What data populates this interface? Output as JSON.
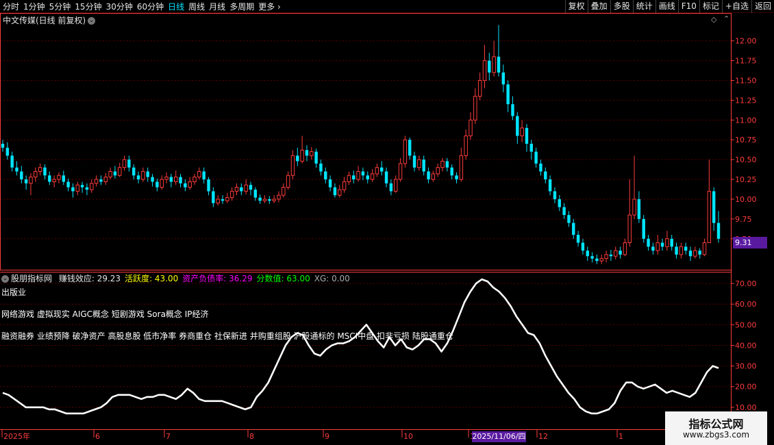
{
  "toolbar": {
    "periods": [
      "分时",
      "1分钟",
      "5分钟",
      "15分钟",
      "30分钟",
      "60分钟",
      "日线",
      "周线",
      "月线",
      "多周期",
      "更多 ›"
    ],
    "active_period": "日线",
    "tools": [
      "复权",
      "叠加",
      "多股",
      "统计",
      "画线",
      "F10",
      "标记",
      "+自选",
      "返回"
    ]
  },
  "main_panel": {
    "title": "中文传媒(日线 前复权)",
    "current_price": "9.31"
  },
  "indicator_panel": {
    "name": "股朋指标网",
    "fields": [
      {
        "label": "赚钱效应: ",
        "value": "29.23",
        "color": "#e6e6e6"
      },
      {
        "label": "活跃度: ",
        "value": "43.00",
        "color": "#ffff00"
      },
      {
        "label": "资产负债率: ",
        "value": "36.29",
        "color": "#ff00ff"
      },
      {
        "label": "分数值: ",
        "value": "63.00",
        "color": "#00ff00"
      },
      {
        "label": "XG: ",
        "value": "0.00",
        "color": "#aaaaaa"
      }
    ],
    "overlay_lines": [
      "出版业",
      "网络游戏 虚拟现实 AIGC概念 短剧游戏 Sora概念 IP经济",
      "融资融券 业绩预降 破净资产 高股息股 低市净率 券商重仓 社保新进 并购重组股 沪股通标的 MSCI中盘 扣非亏损 陆股通重仓"
    ]
  },
  "x_axis": {
    "labels": [
      "2025年",
      "6",
      "7",
      "8",
      "9",
      "10",
      "11",
      "12",
      "1"
    ],
    "crosshair_date": "2025/11/06/四"
  },
  "watermark": {
    "title": "指标公式网",
    "url": "www.zbgs3.com"
  },
  "colors": {
    "up": "#ff3c3c",
    "down": "#00e5ff",
    "line": "#ffffff",
    "grid": "#5a0000",
    "axis": "#ff3c3c"
  },
  "chart_data": [
    {
      "type": "candlestick",
      "title": "中文传媒(日线 前复权)",
      "ylim": [
        9.1,
        12.3
      ],
      "y_ticks": [
        9.5,
        9.75,
        10.0,
        10.25,
        10.5,
        10.75,
        11.0,
        11.25,
        11.5,
        11.75,
        12.0
      ],
      "points": [
        [
          10.7,
          10.65,
          10.75,
          10.6
        ],
        [
          10.65,
          10.55,
          10.72,
          10.5
        ],
        [
          10.55,
          10.4,
          10.6,
          10.35
        ],
        [
          10.4,
          10.35,
          10.48,
          10.3
        ],
        [
          10.35,
          10.25,
          10.42,
          10.2
        ],
        [
          10.25,
          10.2,
          10.3,
          10.12
        ],
        [
          10.2,
          10.28,
          10.33,
          10.05
        ],
        [
          10.28,
          10.35,
          10.4,
          10.22
        ],
        [
          10.35,
          10.4,
          10.45,
          10.3
        ],
        [
          10.4,
          10.3,
          10.44,
          10.25
        ],
        [
          10.3,
          10.22,
          10.35,
          10.18
        ],
        [
          10.22,
          10.25,
          10.3,
          10.15
        ],
        [
          10.25,
          10.3,
          10.34,
          10.2
        ],
        [
          10.3,
          10.22,
          10.36,
          10.18
        ],
        [
          10.22,
          10.15,
          10.26,
          10.1
        ],
        [
          10.15,
          10.1,
          10.2,
          10.02
        ],
        [
          10.1,
          10.18,
          10.22,
          10.05
        ],
        [
          10.18,
          10.15,
          10.22,
          10.08
        ],
        [
          10.15,
          10.12,
          10.2,
          10.05
        ],
        [
          10.12,
          10.2,
          10.25,
          10.08
        ],
        [
          10.2,
          10.25,
          10.3,
          10.16
        ],
        [
          10.25,
          10.22,
          10.3,
          10.18
        ],
        [
          10.22,
          10.28,
          10.33,
          10.18
        ],
        [
          10.28,
          10.35,
          10.4,
          10.25
        ],
        [
          10.35,
          10.3,
          10.42,
          10.26
        ],
        [
          10.3,
          10.4,
          10.46,
          10.28
        ],
        [
          10.4,
          10.5,
          10.55,
          10.36
        ],
        [
          10.5,
          10.4,
          10.55,
          10.35
        ],
        [
          10.4,
          10.3,
          10.44,
          10.25
        ],
        [
          10.3,
          10.25,
          10.35,
          10.2
        ],
        [
          10.25,
          10.35,
          10.4,
          10.22
        ],
        [
          10.35,
          10.28,
          10.4,
          10.22
        ],
        [
          10.28,
          10.22,
          10.32,
          10.16
        ],
        [
          10.22,
          10.15,
          10.26,
          10.1
        ],
        [
          10.15,
          10.25,
          10.3,
          10.12
        ],
        [
          10.25,
          10.28,
          10.34,
          10.2
        ],
        [
          10.28,
          10.22,
          10.32,
          10.15
        ],
        [
          10.22,
          10.28,
          10.36,
          10.18
        ],
        [
          10.28,
          10.2,
          10.32,
          10.15
        ],
        [
          10.2,
          10.15,
          10.25,
          10.1
        ],
        [
          10.15,
          10.22,
          10.28,
          10.12
        ],
        [
          10.22,
          10.28,
          10.32,
          10.18
        ],
        [
          10.28,
          10.35,
          10.4,
          10.25
        ],
        [
          10.35,
          10.25,
          10.4,
          10.2
        ],
        [
          10.25,
          10.1,
          10.28,
          10.05
        ],
        [
          10.1,
          9.95,
          10.15,
          9.9
        ],
        [
          9.95,
          10.0,
          10.05,
          9.92
        ],
        [
          10.0,
          9.98,
          10.05,
          9.94
        ],
        [
          9.98,
          10.02,
          10.08,
          9.95
        ],
        [
          10.02,
          10.1,
          10.15,
          9.98
        ],
        [
          10.1,
          10.15,
          10.2,
          10.05
        ],
        [
          10.15,
          10.1,
          10.2,
          10.05
        ],
        [
          10.1,
          10.18,
          10.25,
          10.06
        ],
        [
          10.18,
          10.12,
          10.22,
          10.05
        ],
        [
          10.12,
          10.02,
          10.15,
          9.98
        ],
        [
          10.02,
          9.98,
          10.06,
          9.94
        ],
        [
          9.98,
          10.0,
          10.05,
          9.95
        ],
        [
          10.0,
          9.98,
          10.04,
          9.94
        ],
        [
          9.98,
          10.0,
          10.05,
          9.95
        ],
        [
          10.0,
          10.05,
          10.1,
          9.96
        ],
        [
          10.05,
          10.15,
          10.2,
          10.02
        ],
        [
          10.15,
          10.3,
          10.35,
          10.12
        ],
        [
          10.3,
          10.55,
          10.62,
          10.25
        ],
        [
          10.55,
          10.48,
          10.65,
          10.42
        ],
        [
          10.48,
          10.62,
          10.8,
          10.45
        ],
        [
          10.62,
          10.55,
          10.68,
          10.48
        ],
        [
          10.55,
          10.6,
          10.66,
          10.5
        ],
        [
          10.6,
          10.45,
          10.64,
          10.4
        ],
        [
          10.45,
          10.35,
          10.5,
          10.3
        ],
        [
          10.35,
          10.25,
          10.4,
          10.2
        ],
        [
          10.25,
          10.15,
          10.3,
          10.1
        ],
        [
          10.15,
          10.05,
          10.2,
          10.02
        ],
        [
          10.05,
          10.12,
          10.18,
          10.02
        ],
        [
          10.12,
          10.22,
          10.28,
          10.08
        ],
        [
          10.22,
          10.3,
          10.35,
          10.18
        ],
        [
          10.3,
          10.25,
          10.36,
          10.2
        ],
        [
          10.25,
          10.35,
          10.42,
          10.22
        ],
        [
          10.35,
          10.3,
          10.4,
          10.24
        ],
        [
          10.3,
          10.25,
          10.35,
          10.2
        ],
        [
          10.25,
          10.32,
          10.38,
          10.22
        ],
        [
          10.32,
          10.4,
          10.45,
          10.28
        ],
        [
          10.4,
          10.35,
          10.48,
          10.3
        ],
        [
          10.35,
          10.2,
          10.4,
          10.15
        ],
        [
          10.2,
          10.1,
          10.25,
          10.05
        ],
        [
          10.1,
          10.25,
          10.3,
          10.08
        ],
        [
          10.25,
          10.45,
          10.52,
          10.22
        ],
        [
          10.45,
          10.75,
          10.8,
          10.4
        ],
        [
          10.75,
          10.55,
          10.78,
          10.5
        ],
        [
          10.55,
          10.4,
          10.6,
          10.35
        ],
        [
          10.4,
          10.5,
          10.55,
          10.36
        ],
        [
          10.5,
          10.35,
          10.55,
          10.3
        ],
        [
          10.35,
          10.25,
          10.4,
          10.2
        ],
        [
          10.25,
          10.32,
          10.36,
          10.22
        ],
        [
          10.32,
          10.4,
          10.45,
          10.28
        ],
        [
          10.4,
          10.48,
          10.52,
          10.35
        ],
        [
          10.48,
          10.4,
          10.52,
          10.35
        ],
        [
          10.4,
          10.3,
          10.44,
          10.25
        ],
        [
          10.3,
          10.25,
          10.34,
          10.2
        ],
        [
          10.25,
          10.55,
          10.65,
          10.22
        ],
        [
          10.55,
          10.8,
          10.88,
          10.5
        ],
        [
          10.8,
          11.0,
          11.1,
          10.75
        ],
        [
          11.0,
          11.3,
          11.4,
          10.95
        ],
        [
          11.3,
          11.5,
          11.6,
          11.25
        ],
        [
          11.5,
          11.75,
          11.95,
          11.4
        ],
        [
          11.75,
          11.6,
          11.85,
          11.5
        ],
        [
          11.6,
          11.8,
          12.0,
          11.55
        ],
        [
          11.8,
          11.6,
          12.2,
          11.55
        ],
        [
          11.6,
          11.45,
          11.7,
          11.35
        ],
        [
          11.45,
          11.2,
          11.5,
          11.1
        ],
        [
          11.2,
          11.05,
          11.3,
          11.0
        ],
        [
          11.05,
          10.8,
          11.1,
          10.7
        ],
        [
          10.8,
          10.9,
          11.0,
          10.72
        ],
        [
          10.9,
          10.7,
          10.95,
          10.6
        ],
        [
          10.7,
          10.6,
          10.75,
          10.5
        ],
        [
          10.6,
          10.45,
          10.65,
          10.4
        ],
        [
          10.45,
          10.35,
          10.5,
          10.3
        ],
        [
          10.35,
          10.25,
          10.4,
          10.2
        ],
        [
          10.25,
          10.1,
          10.3,
          10.05
        ],
        [
          10.1,
          10.0,
          10.15,
          9.95
        ],
        [
          10.0,
          9.9,
          10.05,
          9.85
        ],
        [
          9.9,
          9.8,
          9.95,
          9.75
        ],
        [
          9.8,
          9.7,
          9.85,
          9.65
        ],
        [
          9.7,
          9.55,
          9.75,
          9.5
        ],
        [
          9.55,
          9.45,
          9.6,
          9.4
        ],
        [
          9.45,
          9.35,
          9.5,
          9.3
        ],
        [
          9.35,
          9.28,
          9.4,
          9.22
        ],
        [
          9.28,
          9.25,
          9.33,
          9.2
        ],
        [
          9.25,
          9.22,
          9.3,
          9.18
        ],
        [
          9.22,
          9.25,
          9.3,
          9.18
        ],
        [
          9.25,
          9.3,
          9.35,
          9.2
        ],
        [
          9.3,
          9.28,
          9.36,
          9.22
        ],
        [
          9.28,
          9.35,
          9.4,
          9.24
        ],
        [
          9.35,
          9.3,
          9.4,
          9.25
        ],
        [
          9.3,
          9.45,
          9.5,
          9.28
        ],
        [
          9.45,
          9.8,
          10.25,
          9.4
        ],
        [
          9.8,
          10.0,
          10.55,
          9.75
        ],
        [
          10.0,
          9.75,
          10.1,
          9.7
        ],
        [
          9.75,
          9.5,
          9.8,
          9.45
        ],
        [
          9.5,
          9.4,
          9.55,
          9.35
        ],
        [
          9.4,
          9.35,
          9.45,
          9.3
        ],
        [
          9.35,
          9.45,
          9.55,
          9.3
        ],
        [
          9.45,
          9.4,
          9.5,
          9.35
        ],
        [
          9.4,
          9.5,
          9.6,
          9.35
        ],
        [
          9.5,
          9.4,
          9.55,
          9.35
        ],
        [
          9.4,
          9.3,
          9.45,
          9.25
        ],
        [
          9.3,
          9.4,
          9.45,
          9.25
        ],
        [
          9.4,
          9.35,
          9.45,
          9.3
        ],
        [
          9.35,
          9.28,
          9.4,
          9.22
        ],
        [
          9.28,
          9.35,
          9.4,
          9.25
        ],
        [
          9.35,
          9.3,
          9.38,
          9.25
        ],
        [
          9.3,
          9.45,
          9.5,
          9.28
        ],
        [
          9.45,
          10.1,
          10.5,
          9.45
        ],
        [
          10.1,
          9.7,
          10.15,
          9.6
        ],
        [
          9.7,
          9.5,
          9.85,
          9.45
        ]
      ]
    },
    {
      "type": "line",
      "series": [
        {
          "name": "赚钱效应",
          "values": [
            17,
            16,
            14,
            12,
            10,
            10,
            10,
            10,
            9,
            9,
            8,
            7,
            7,
            7,
            7,
            8,
            9,
            10,
            12,
            15,
            16,
            16,
            16,
            15,
            14,
            15,
            15,
            16,
            16,
            15,
            14,
            16,
            19,
            17,
            14,
            13,
            13,
            13,
            13,
            12,
            11,
            10,
            9,
            10,
            15,
            18,
            22,
            28,
            34,
            40,
            44,
            46,
            45,
            40,
            36,
            35,
            38,
            40,
            41,
            41,
            42,
            44,
            47,
            50,
            46,
            42,
            39,
            44,
            40,
            43,
            39,
            38,
            40,
            43,
            43,
            41,
            37,
            41,
            47,
            54,
            61,
            66,
            70,
            72,
            71,
            68,
            66,
            63,
            59,
            54,
            50,
            46,
            45,
            41,
            35,
            30,
            25,
            21,
            17,
            14,
            10,
            8,
            7,
            7,
            8,
            9,
            12,
            18,
            22,
            22,
            20,
            19,
            20,
            21,
            19,
            17,
            18,
            17,
            16,
            15,
            17,
            22,
            27,
            30,
            29
          ]
        }
      ],
      "ylim": [
        0,
        75
      ],
      "y_ticks": [
        10,
        20,
        30,
        40,
        50,
        60,
        70
      ]
    }
  ]
}
